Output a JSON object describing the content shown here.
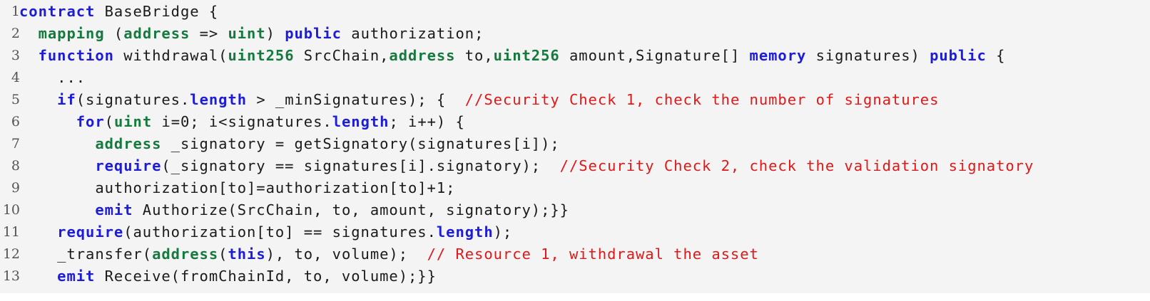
{
  "colors": {
    "background": "#f4f4f4",
    "keyword_blue": "#1d1dd8",
    "keyword_green": "#167a3f",
    "comment_red": "#e01818",
    "text": "#1a1a1a",
    "line_number": "#555555"
  },
  "lines": [
    {
      "number": "1",
      "tokens": [
        {
          "text": "contract",
          "style": "kb"
        },
        {
          "text": " BaseBridge {",
          "style": ""
        }
      ]
    },
    {
      "number": "2",
      "tokens": [
        {
          "text": "  ",
          "style": ""
        },
        {
          "text": "mapping",
          "style": "kg"
        },
        {
          "text": " (",
          "style": ""
        },
        {
          "text": "address",
          "style": "kg"
        },
        {
          "text": " => ",
          "style": ""
        },
        {
          "text": "uint",
          "style": "kg"
        },
        {
          "text": ") ",
          "style": ""
        },
        {
          "text": "public",
          "style": "kb"
        },
        {
          "text": " authorization;",
          "style": ""
        }
      ]
    },
    {
      "number": "3",
      "tokens": [
        {
          "text": "  ",
          "style": ""
        },
        {
          "text": "function",
          "style": "kb"
        },
        {
          "text": " withdrawal(",
          "style": ""
        },
        {
          "text": "uint256",
          "style": "kg"
        },
        {
          "text": " SrcChain,",
          "style": ""
        },
        {
          "text": "address",
          "style": "kg"
        },
        {
          "text": " to,",
          "style": ""
        },
        {
          "text": "uint256",
          "style": "kg"
        },
        {
          "text": " amount,Signature[] ",
          "style": ""
        },
        {
          "text": "memory",
          "style": "kb"
        },
        {
          "text": " signatures) ",
          "style": ""
        },
        {
          "text": "public",
          "style": "kb"
        },
        {
          "text": " {",
          "style": ""
        }
      ]
    },
    {
      "number": "4",
      "tokens": [
        {
          "text": "    ...",
          "style": ""
        }
      ]
    },
    {
      "number": "5",
      "tokens": [
        {
          "text": "    ",
          "style": ""
        },
        {
          "text": "if",
          "style": "kb"
        },
        {
          "text": "(signatures.",
          "style": ""
        },
        {
          "text": "length",
          "style": "kb"
        },
        {
          "text": " > _minSignatures); {  ",
          "style": ""
        },
        {
          "text": "//Security Check 1, check the number of signatures",
          "style": "cm"
        }
      ]
    },
    {
      "number": "6",
      "tokens": [
        {
          "text": "      ",
          "style": ""
        },
        {
          "text": "for",
          "style": "kb"
        },
        {
          "text": "(",
          "style": ""
        },
        {
          "text": "uint",
          "style": "kg"
        },
        {
          "text": " i=0; i<signatures.",
          "style": ""
        },
        {
          "text": "length",
          "style": "kb"
        },
        {
          "text": "; i++) {",
          "style": ""
        }
      ]
    },
    {
      "number": "7",
      "tokens": [
        {
          "text": "        ",
          "style": ""
        },
        {
          "text": "address",
          "style": "kg"
        },
        {
          "text": " _signatory = getSignatory(signatures[i]);",
          "style": ""
        }
      ]
    },
    {
      "number": "8",
      "tokens": [
        {
          "text": "        ",
          "style": ""
        },
        {
          "text": "require",
          "style": "kb"
        },
        {
          "text": "(_signatory == signatures[i].signatory);  ",
          "style": ""
        },
        {
          "text": "//Security Check 2, check the validation signatory",
          "style": "cm"
        }
      ]
    },
    {
      "number": "9",
      "tokens": [
        {
          "text": "        authorization[to]=authorization[to]+1;",
          "style": ""
        }
      ]
    },
    {
      "number": "10",
      "tokens": [
        {
          "text": "        ",
          "style": ""
        },
        {
          "text": "emit",
          "style": "kb"
        },
        {
          "text": " Authorize(SrcChain, to, amount, signatory);}}",
          "style": ""
        }
      ]
    },
    {
      "number": "11",
      "tokens": [
        {
          "text": "    ",
          "style": ""
        },
        {
          "text": "require",
          "style": "kb"
        },
        {
          "text": "(authorization[to] == signatures.",
          "style": ""
        },
        {
          "text": "length",
          "style": "kb"
        },
        {
          "text": ");",
          "style": ""
        }
      ]
    },
    {
      "number": "12",
      "tokens": [
        {
          "text": "    _transfer(",
          "style": ""
        },
        {
          "text": "address",
          "style": "kg"
        },
        {
          "text": "(",
          "style": ""
        },
        {
          "text": "this",
          "style": "kb"
        },
        {
          "text": "), to, volume);  ",
          "style": ""
        },
        {
          "text": "// Resource 1, withdrawal the asset",
          "style": "cm"
        }
      ]
    },
    {
      "number": "13",
      "tokens": [
        {
          "text": "    ",
          "style": ""
        },
        {
          "text": "emit",
          "style": "kb"
        },
        {
          "text": " Receive(fromChainId, to, volume);}}",
          "style": ""
        }
      ]
    }
  ]
}
